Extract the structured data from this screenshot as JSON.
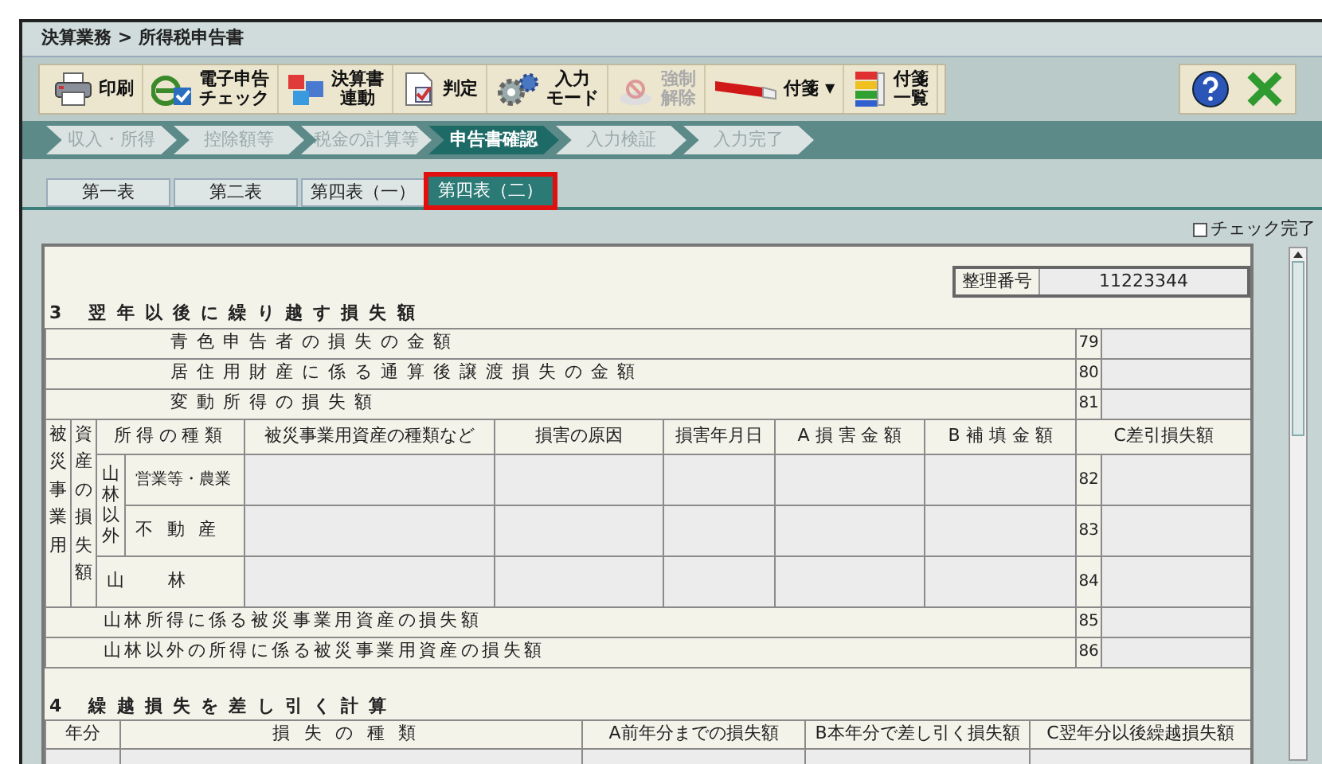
{
  "breadcrumb": "決算業務 > 所得税申告書",
  "toolbar": [
    {
      "kind": "print",
      "lines": [
        "印刷"
      ],
      "disabled": false
    },
    {
      "kind": "e-filing",
      "lines": [
        "電子申告",
        "チェック"
      ],
      "disabled": false
    },
    {
      "kind": "link",
      "lines": [
        "決算書",
        "連動"
      ],
      "disabled": false
    },
    {
      "kind": "judge",
      "lines": [
        "判定"
      ],
      "disabled": false
    },
    {
      "kind": "gear",
      "lines": [
        "入力",
        "モード"
      ],
      "disabled": false
    },
    {
      "kind": "release",
      "lines": [
        "強制",
        "解除"
      ],
      "disabled": true
    },
    {
      "kind": "sticky",
      "lines": [
        "付箋"
      ],
      "dropdown": "▼",
      "disabled": false
    },
    {
      "kind": "list",
      "lines": [
        "付箋",
        "一覧"
      ],
      "disabled": false
    }
  ],
  "steps": [
    {
      "label": "収入・所得",
      "selected": false
    },
    {
      "label": "控除額等",
      "selected": false
    },
    {
      "label": "税金の計算等",
      "selected": false
    },
    {
      "label": "申告書確認",
      "selected": true
    },
    {
      "label": "入力検証",
      "selected": false
    },
    {
      "label": "入力完了",
      "selected": false
    }
  ],
  "tabs": [
    {
      "label": "第一表",
      "selected": false
    },
    {
      "label": "第二表",
      "selected": false
    },
    {
      "label": "第四表（一）",
      "selected": false
    },
    {
      "label": "第四表（二）",
      "selected": true
    }
  ],
  "check_complete": {
    "label": "チェック完了",
    "checked": false
  },
  "form": {
    "serial_label": "整理番号",
    "serial_value": "11223344",
    "section3": {
      "title": "3 翌年以後に繰り越す損失額",
      "rows": [
        {
          "label": "青色申告者の損失の金額",
          "line": "79"
        },
        {
          "label": "居住用財産に係る通算後譲渡損失の金額",
          "line": "80"
        },
        {
          "label": "変動所得の損失額",
          "line": "81"
        }
      ],
      "damage": {
        "side_labels": [
          "被災事業用",
          "資産の損失額"
        ],
        "columns": [
          "所得の種類",
          "被災事業用資産の種類など",
          "損害の原因",
          "損害年月日",
          "A 損 害 金 額",
          "B 補 填 金 額",
          "C差引損失額"
        ],
        "group_label": "山林以外",
        "rows": [
          {
            "label": "営業等・農業",
            "line": "82"
          },
          {
            "label": "不動産",
            "line": "83"
          },
          {
            "label": "山林",
            "line": "84"
          }
        ]
      },
      "after_rows": [
        {
          "label": "山林所得に係る被災事業用資産の損失額",
          "line": "85"
        },
        {
          "label": "山林以外の所得に係る被災事業用資産の損失額",
          "line": "86"
        }
      ]
    },
    "section4": {
      "title": "4 繰越損失を差し引く計算",
      "columns": [
        "年分",
        "損失の種類",
        "A前年分までの損失額",
        "B本年分で差し引く損失額",
        "C翌年分以後繰越損失額"
      ]
    }
  }
}
